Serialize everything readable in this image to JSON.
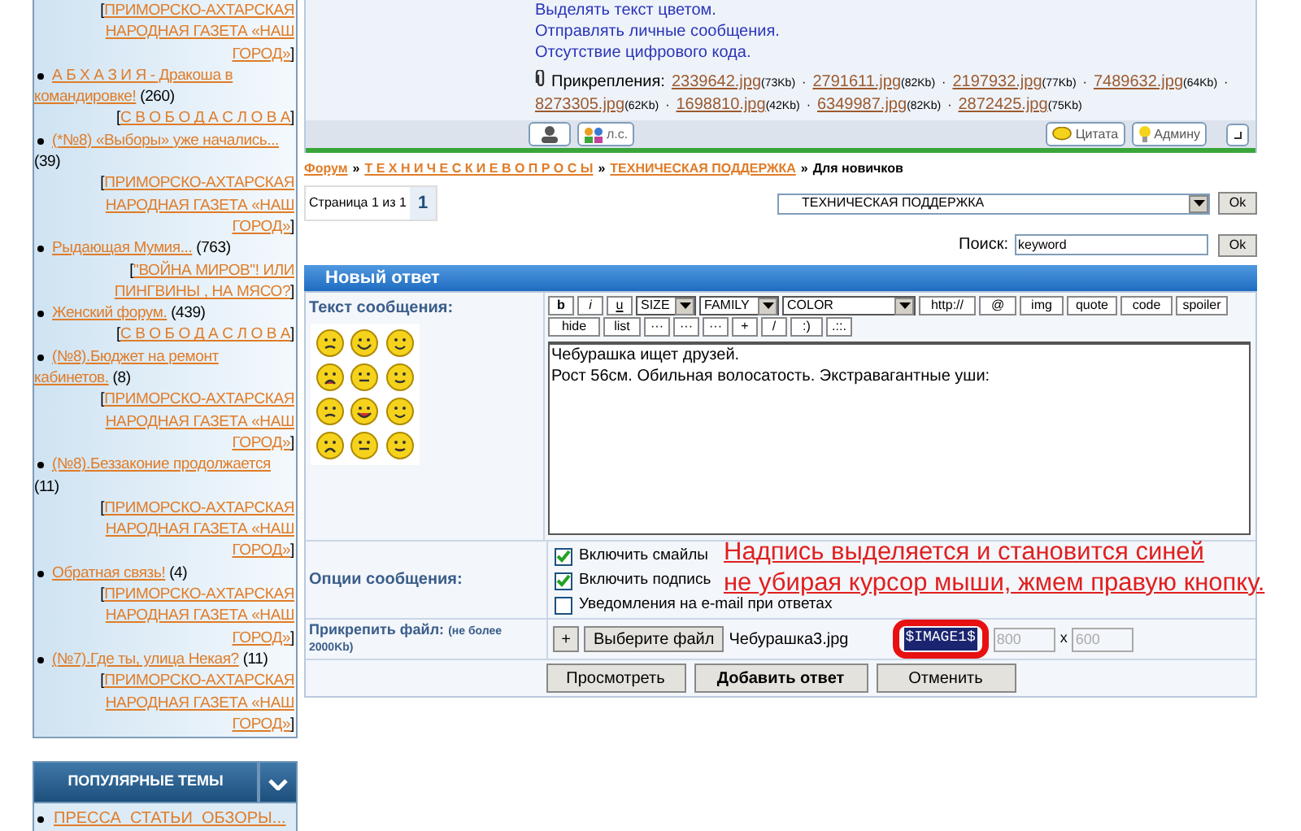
{
  "sidebar": {
    "bracket_open": "[",
    "bracket_close": "]",
    "items": [
      {
        "forum": "ПРИМОРСКО-АХТАРСКАЯ НАРОДНАЯ ГАЗЕТА «НАШ ГОРОД»"
      },
      {
        "title": "А Б Х А З И Я - Дракоша в командировке!",
        "count": "(260)",
        "forum": "С В О Б О Д А С Л О В А"
      },
      {
        "title": "(*№8) «Выборы» уже начались...",
        "count": "(39)",
        "forum": "ПРИМОРСКО-АХТАРСКАЯ НАРОДНАЯ ГАЗЕТА «НАШ ГОРОД»"
      },
      {
        "title": "Рыдающая Мумия...",
        "count": "(763)",
        "forum": "\"ВОЙНА МИРОВ\"! ИЛИ ПИНГВИНЫ , НА МЯСО?"
      },
      {
        "title": "Женский форум.",
        "count": "(439)",
        "forum": "С В О Б О Д А С Л О В А"
      },
      {
        "title": "(№8).Бюджет на ремонт кабинетов.",
        "count": "(8)",
        "forum": "ПРИМОРСКО-АХТАРСКАЯ НАРОДНАЯ ГАЗЕТА «НАШ ГОРОД»"
      },
      {
        "title": "(№8).Беззаконие продолжается",
        "count": "(11)",
        "forum": "ПРИМОРСКО-АХТАРСКАЯ НАРОДНАЯ ГАЗЕТА «НАШ ГОРОД»"
      },
      {
        "title": "Обратная связь!",
        "count": "(4)",
        "forum": "ПРИМОРСКО-АХТАРСКАЯ НАРОДНАЯ ГАЗЕТА «НАШ ГОРОД»"
      },
      {
        "title": "(№7).Где ты, улица Некая?",
        "count": "(11)",
        "forum": "ПРИМОРСКО-АХТАРСКАЯ НАРОДНАЯ ГАЗЕТА «НАШ ГОРОД»"
      }
    ]
  },
  "popular": {
    "title": "ПОПУЛЯРНЫЕ ТЕМЫ",
    "items": [
      "ПРЕССА_СТАТЬИ_ОБЗОРЫ..."
    ]
  },
  "post": {
    "lines": [
      "Выделять текст цветом.",
      "Отправлять личные сообщения.",
      "Отсутствие цифрового кода."
    ],
    "attachments_label": "Прикрепления:",
    "separator": "·",
    "attachments": [
      {
        "name": "2339642.jpg",
        "size": "(73Kb)"
      },
      {
        "name": "2791611.jpg",
        "size": "(82Kb)"
      },
      {
        "name": "2197932.jpg",
        "size": "(77Kb)"
      },
      {
        "name": "7489632.jpg",
        "size": "(64Kb)"
      },
      {
        "name": "8273305.jpg",
        "size": "(62Kb)"
      },
      {
        "name": "1698810.jpg",
        "size": "(42Kb)"
      },
      {
        "name": "6349987.jpg",
        "size": "(82Kb)"
      },
      {
        "name": "2872425.jpg",
        "size": "(75Kb)"
      }
    ],
    "pm_label": "л.с.",
    "quote_label": "Цитата",
    "admin_label": "Админу"
  },
  "breadcrumb": {
    "separator": "»",
    "links": [
      "Форум",
      "Т Е Х Н И Ч Е С К И Е В О П Р О С Ы",
      "ТЕХНИЧЕСКАЯ ПОДДЕРЖКА"
    ],
    "current": "Для новичков"
  },
  "pagination": {
    "label": "Страница 1 из 1",
    "pages": [
      {
        "label": "1",
        "selected": true
      }
    ]
  },
  "jump": {
    "value": "ТЕХНИЧЕСКАЯ ПОДДЕРЖКА",
    "button": "Ok"
  },
  "search": {
    "label": "Поиск:",
    "value": "keyword",
    "button": "Ok"
  },
  "form": {
    "title": "Новый ответ",
    "message_label": "Текст сообщения:",
    "toolbar": [
      {
        "kind": "button",
        "label": "b"
      },
      {
        "kind": "button",
        "label": "i"
      },
      {
        "kind": "button",
        "label": "u"
      },
      {
        "kind": "select",
        "label": "SIZE"
      },
      {
        "kind": "select",
        "label": "FAMILY"
      },
      {
        "kind": "select",
        "label": "COLOR"
      },
      {
        "kind": "button",
        "label": "http://"
      },
      {
        "kind": "button",
        "label": "@"
      },
      {
        "kind": "button",
        "label": "img"
      },
      {
        "kind": "button",
        "label": "quote"
      },
      {
        "kind": "button",
        "label": "code"
      },
      {
        "kind": "button",
        "label": "spoiler"
      },
      {
        "kind": "break"
      },
      {
        "kind": "button",
        "label": "hide"
      },
      {
        "kind": "button",
        "label": "list"
      },
      {
        "kind": "button",
        "label": "···"
      },
      {
        "kind": "button",
        "label": "···"
      },
      {
        "kind": "button",
        "label": "···"
      },
      {
        "kind": "button",
        "label": "+"
      },
      {
        "kind": "button",
        "label": "/"
      },
      {
        "kind": "button",
        "label": ":)"
      },
      {
        "kind": "button",
        "label": ".::."
      }
    ],
    "message": "Чебурашка ищет друзей.\nРост 56см. Обильная волосатость. Экстравагантные уши:",
    "options_label": "Опции сообщения:",
    "options": [
      {
        "label": "Включить смайлы",
        "checked": true
      },
      {
        "label": "Включить подпись",
        "checked": true
      },
      {
        "label": "Уведомления на e-mail при ответах",
        "checked": false
      }
    ],
    "annotation": [
      "Надпись выделяется и становится синей",
      "не убирая курсор мыши, жмем правую кнопку."
    ],
    "attach_label": "Прикрепить файл:",
    "attach_note": "(не более 2000Kb)",
    "add_button": "+",
    "choose_button": "Выберите файл",
    "file_name": "Чебурашка3.jpg",
    "image_tag": "$IMAGE1$",
    "image_tag_selected": true,
    "circled": true,
    "width_placeholder": "800",
    "times": "x",
    "height_placeholder": "600",
    "buttons": [
      {
        "label": "Просмотреть",
        "primary": false
      },
      {
        "label": "Добавить ответ",
        "primary": true
      },
      {
        "label": "Отменить",
        "primary": false
      }
    ]
  }
}
